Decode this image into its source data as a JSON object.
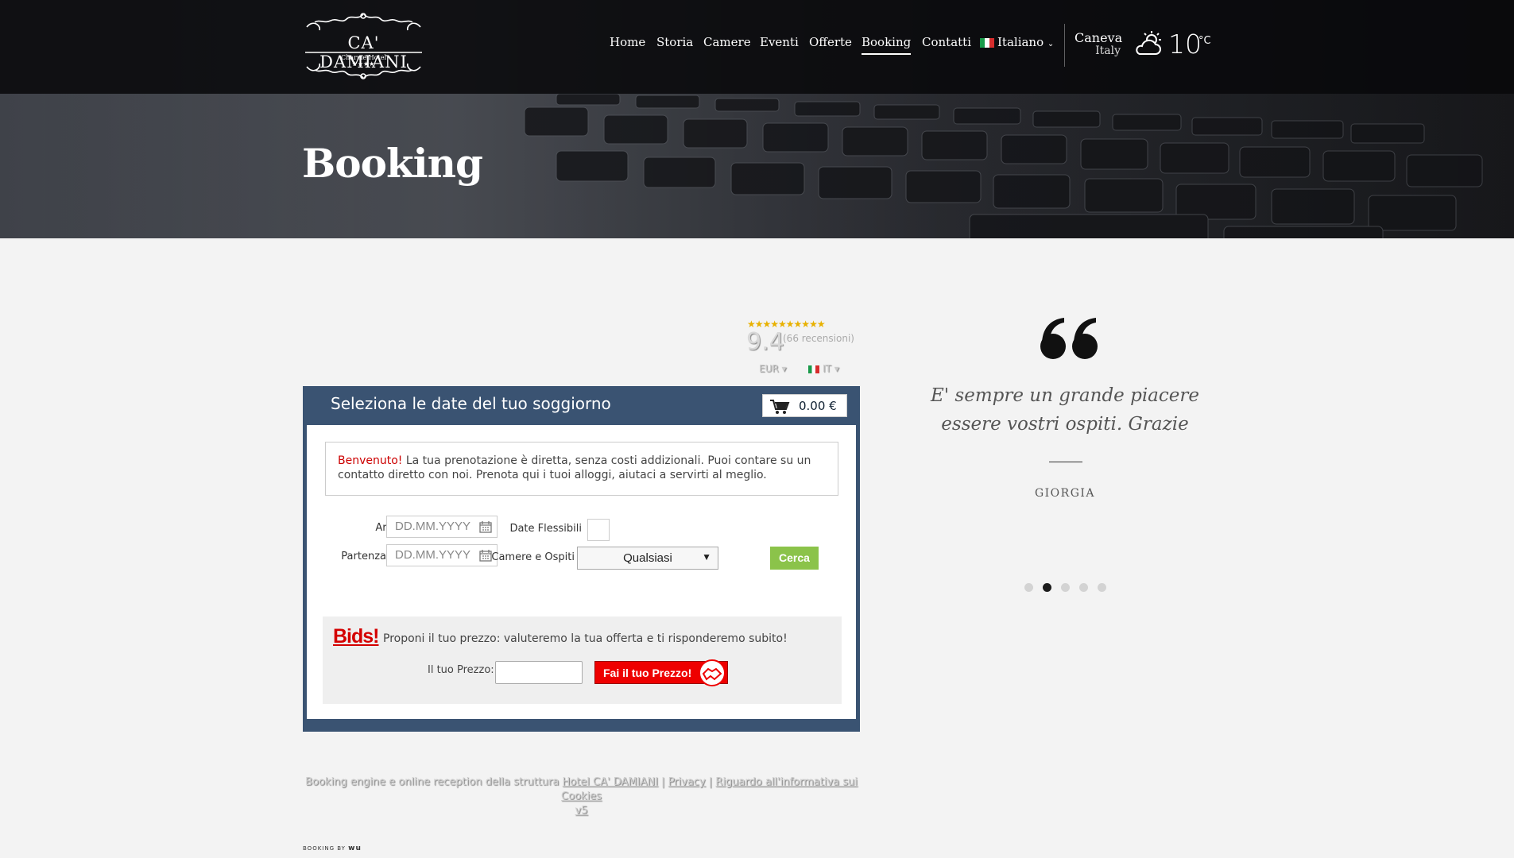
{
  "hotel": {
    "logo_name": "CA' DAMIANI",
    "logo_sub": "Charme Hotel"
  },
  "nav": {
    "items": [
      {
        "label": "Home"
      },
      {
        "label": "Storia"
      },
      {
        "label": "Camere"
      },
      {
        "label": "Eventi"
      },
      {
        "label": "Offerte"
      },
      {
        "label": "Booking",
        "active": true
      },
      {
        "label": "Contatti"
      }
    ],
    "language": "Italiano"
  },
  "weather": {
    "city": "Caneva",
    "country": "Italy",
    "temperature": "10",
    "unit": "°C",
    "icon": "partly-cloudy-icon"
  },
  "hero": {
    "title": "Booking"
  },
  "rating": {
    "stars": "★★★★★★★★★★",
    "score": "9.4",
    "reviews": "(66 recensioni)",
    "currency": "EUR",
    "language": "IT"
  },
  "widget": {
    "header": "Seleziona le date del tuo soggiorno",
    "cart_total": "0.00 €",
    "welcome_bold": "Benvenuto!",
    "welcome_text": " La tua prenotazione è diretta, senza costi addizionali. Puoi contare su un contatto diretto con noi. Prenota qui i tuoi alloggi, aiutaci a servirti al meglio.",
    "arrival_label": "Arrivo",
    "departure_label": "Partenza",
    "date_placeholder": "DD.MM.YYYY",
    "flex_dates_label": "Date Flessibili",
    "rooms_guests_label": "Camere e Ospiti",
    "rooms_guests_value": "Qualsiasi",
    "search_button": "Cerca"
  },
  "bids": {
    "title": "Bids!",
    "text": "Proponi il tuo prezzo: valuteremo la tua offerta e ti risponderemo subito!",
    "price_label": "Il tuo Prezzo:",
    "button": "Fai il tuo Prezzo!"
  },
  "footer": {
    "prefix": "Booking engine e online reception della struttura ",
    "hotel_link": "Hotel CA' DAMIANI",
    "sep1": " | ",
    "privacy_link": "Privacy",
    "sep2": " | ",
    "cookies_link": "Riguardo all'informativa sui Cookies",
    "version_link": "v5",
    "booking_by": "BOOKING BY",
    "booking_by_brand": "wu"
  },
  "testimonial": {
    "quote": "E' sempre un grande piacere essere vostri ospiti. Grazie",
    "author": "GIORGIA",
    "slide_count": 5,
    "active_slide": 2
  }
}
